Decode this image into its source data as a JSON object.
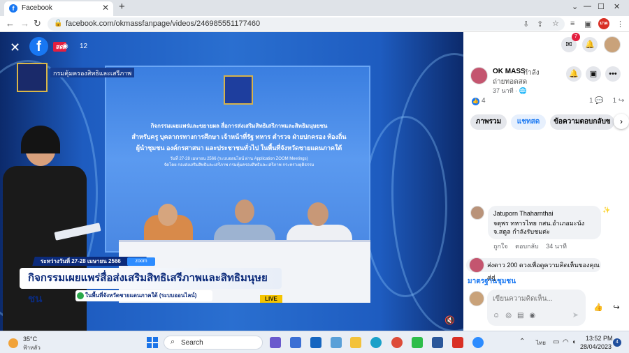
{
  "browser": {
    "tab_title": "Facebook",
    "url": "facebook.com/okmassfanpage/videos/246985551177460",
    "tab_icon": "facebook-icon",
    "new_tab": "+",
    "win_min": "—",
    "win_max": "☐",
    "win_close": "✕",
    "profile_label": "ม่วด"
  },
  "video": {
    "live_label": "สด",
    "viewer_count": "12",
    "org_name": "กรมคุ้มครองสิทธิและเสรีภาพ",
    "backdrop": {
      "line1": "กิจกรรมเผยแพร่และขยายผล สื่อการส่งเสริมสิทธิเสรีภาพและสิทธิมนุษยชน",
      "line2": "สำหรับครู บุคลากรทางการศึกษา เจ้าหน้าที่รัฐ ทหาร ตำรวจ ฝ่ายปกครอง ท้องถิ่น",
      "line3": "ผู้นำชุมชน องค์กรศาสนา และประชาชนทั่วไป ในพื้นที่จังหวัดชายแดนภาคใต้",
      "line4": "วันที่ 27-28 เมษายน 2566 (ระบบออนไลน์ ผ่าน Application ZOOM Meetings)",
      "line5": "จัดโดย กองส่งเสริมสิทธิและเสรีภาพ กรมคุ้มครองสิทธิและเสรีภาพ กระทรวงยุติธรรม"
    },
    "lower_date": "ระหว่างวันที่ 27-28 เมษายน 2566",
    "zoom_label": "zoom",
    "lower_title": "กิจกรรมเผยแพร่สื่อส่งเสริมสิทธิเสรีภาพและสิทธิมนุษยชน",
    "lower_sub": "ในพื้นที่จังหวัดชายแดนภาคใต้ (ระบบออนไลน์)",
    "live_tag": "LIVE"
  },
  "panel": {
    "messenger_badge": "7",
    "page_name": "OK MASS",
    "status_1": "กำลัง",
    "status_2": "ถ่ายทอดสด",
    "time_ago": "37 นาที · 🌐",
    "reaction_count": "4",
    "comment_count": "1",
    "share_count": "1",
    "tabs": [
      "ภาพรวม",
      "แชทสด",
      "ข้อความตอบกลับข"
    ],
    "comment1": {
      "author": "Jatuporn Thaharnthai",
      "text": "จตุพร ทหารไทย กสน.อำเภอมะนัง จ.สตูล กำลังรับชมค่ะ",
      "like": "ถูกใจ",
      "reply": "ตอบกลับ",
      "time": "34 นาที"
    },
    "comment2": "ส่งดาว 200 ดวงเพื่อดูความคิดเห็นของคุณที่นี่",
    "standard_link": "มาตรฐานชุมชน",
    "composer_placeholder": "เขียนความคิดเห็น..."
  },
  "taskbar": {
    "temp": "35°C",
    "weather": "ฟ้าหลัว",
    "search": "Search",
    "lang": "ไทย",
    "time": "13:52 PM",
    "date": "28/04/2023",
    "notifications": "4"
  }
}
